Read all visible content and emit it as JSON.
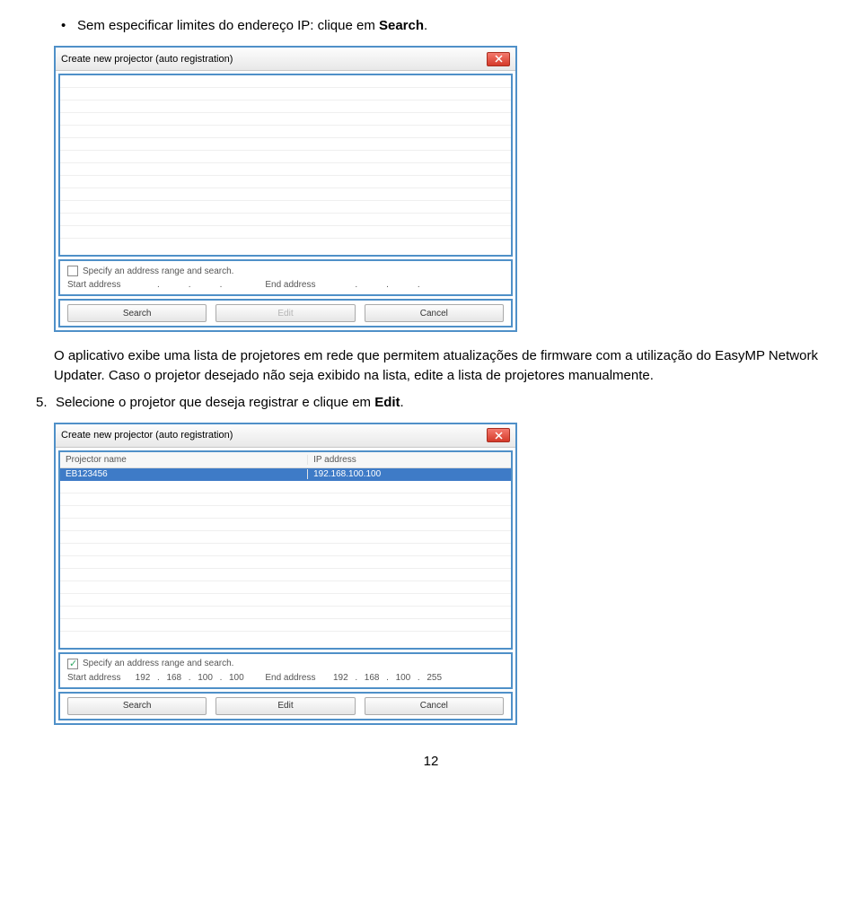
{
  "text": {
    "bullet_line_pre": "Sem especificar limites do endereço IP: clique em ",
    "bullet_line_bold": "Search",
    "bullet_line_post": ".",
    "para1": "O aplicativo exibe uma lista de projetores em rede que permitem atualizações de firmware com a utilização do EasyMP Network Updater. Caso o projetor desejado não seja exibido na lista, edite a lista de projetores manualmente.",
    "step5_num": "5.",
    "step5_pre": "Selecione o projetor que deseja registrar e clique em ",
    "step5_bold": "Edit",
    "step5_post": "."
  },
  "dialog1": {
    "title": "Create new projector (auto registration)",
    "range_checkbox_label": "Specify an address range and search.",
    "start_label": "Start address",
    "end_label": "End address",
    "buttons": {
      "search": "Search",
      "edit": "Edit",
      "cancel": "Cancel"
    }
  },
  "dialog2": {
    "title": "Create new projector (auto registration)",
    "col1": "Projector name",
    "col2": "IP address",
    "row_name": "EB123456",
    "row_ip": "192.168.100.100",
    "range_checkbox_label": "Specify an address range and search.",
    "start_label": "Start address",
    "end_label": "End address",
    "start_ip": [
      "192",
      "168",
      "100",
      "100"
    ],
    "end_ip": [
      "192",
      "168",
      "100",
      "255"
    ],
    "buttons": {
      "search": "Search",
      "edit": "Edit",
      "cancel": "Cancel"
    }
  },
  "page_number": "12"
}
